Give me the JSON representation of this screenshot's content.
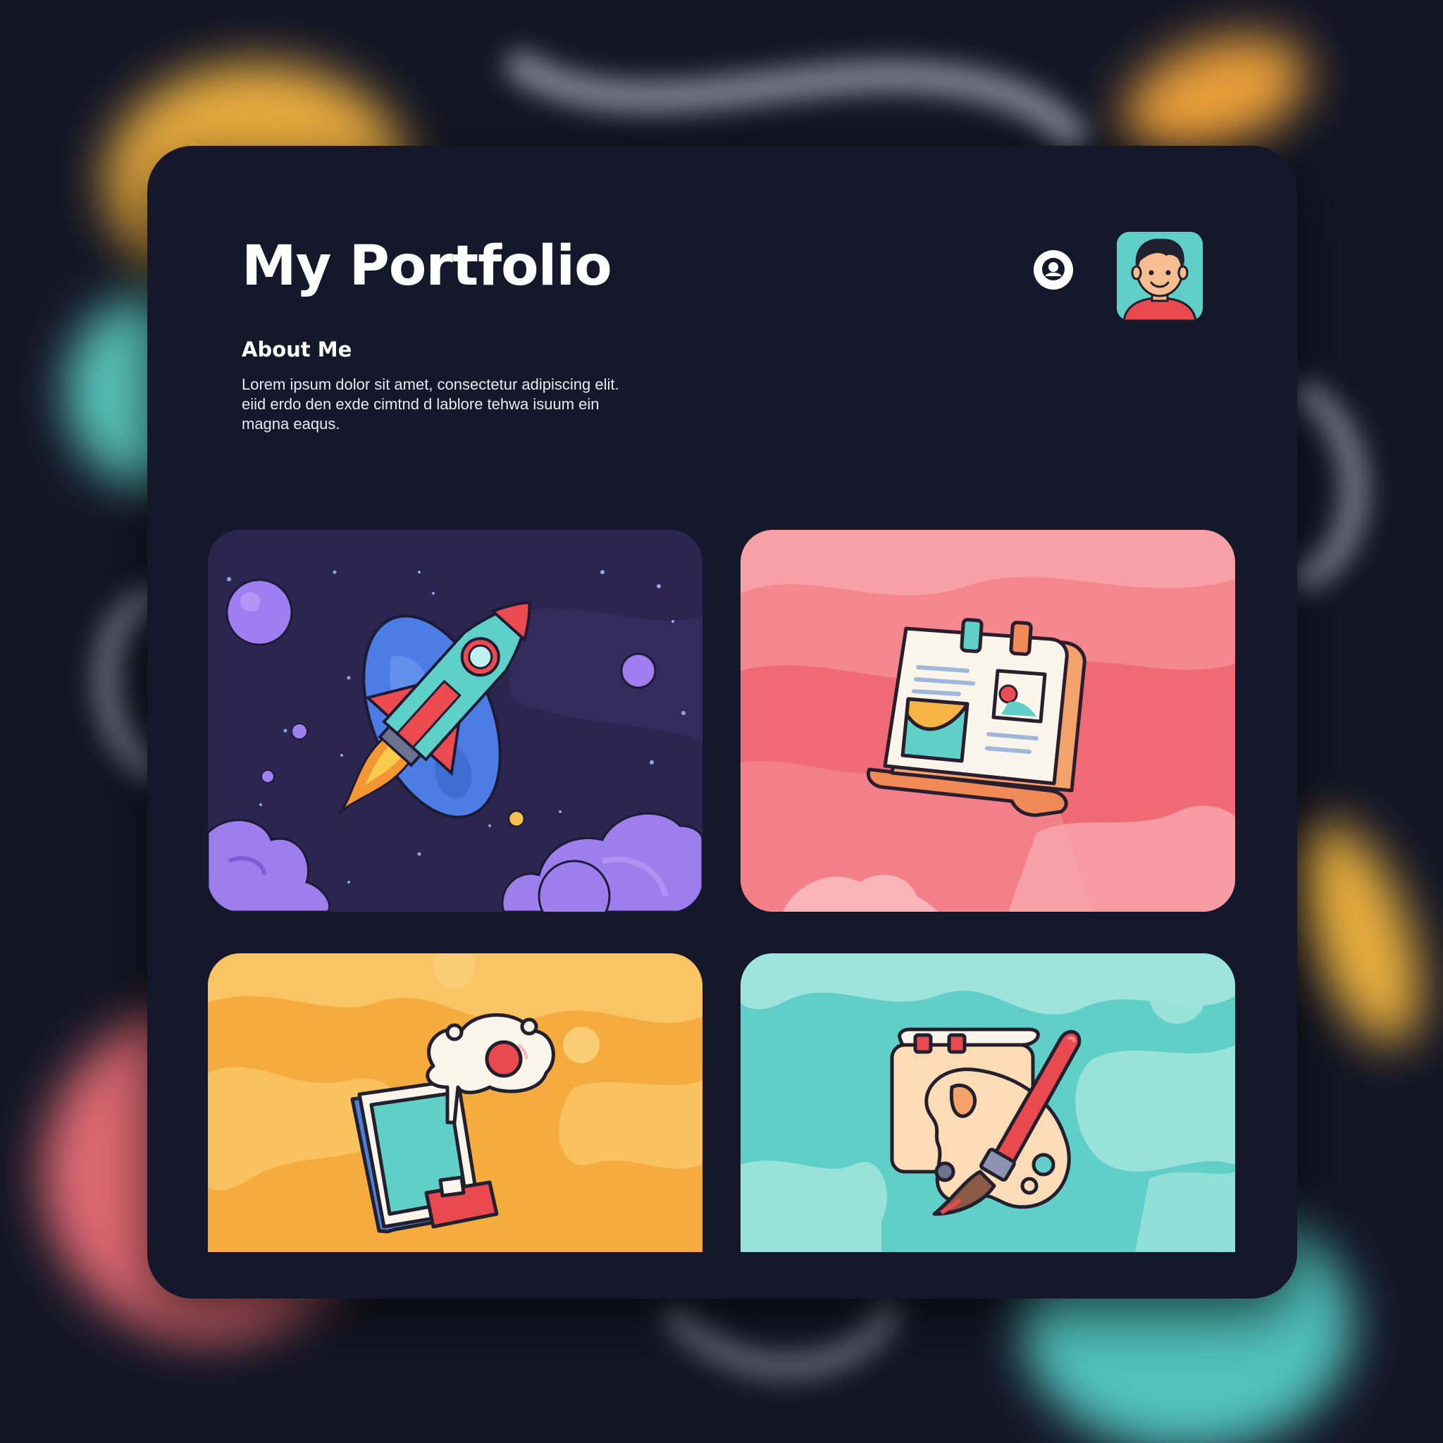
{
  "header": {
    "title": "My Portfolio"
  },
  "about": {
    "heading": "About Me",
    "lines": [
      "Lorem ipsum dolor sit amet, consectetur adipiscing elit.",
      "eiid erdo den exde cimtnd d lablore tehwa isuum ein",
      "magna eaqus."
    ]
  },
  "icons": {
    "profile": "user-circle-icon",
    "avatar": "avatar-face-icon"
  },
  "projects": [
    {
      "icon": "rocket-icon",
      "theme": "space"
    },
    {
      "icon": "calendar-gallery-icon",
      "theme": "pink-waves"
    },
    {
      "icon": "tablet-chat-bubble-icon",
      "theme": "yellow-waves"
    },
    {
      "icon": "paint-palette-brush-icon",
      "theme": "teal-waves"
    }
  ],
  "colors": {
    "background": "#141625",
    "card": "#15172a",
    "space": "#2b2550",
    "pink": "#f47f87",
    "yellow": "#f5b342",
    "teal": "#5fd0c8",
    "text": "#ffffff"
  }
}
